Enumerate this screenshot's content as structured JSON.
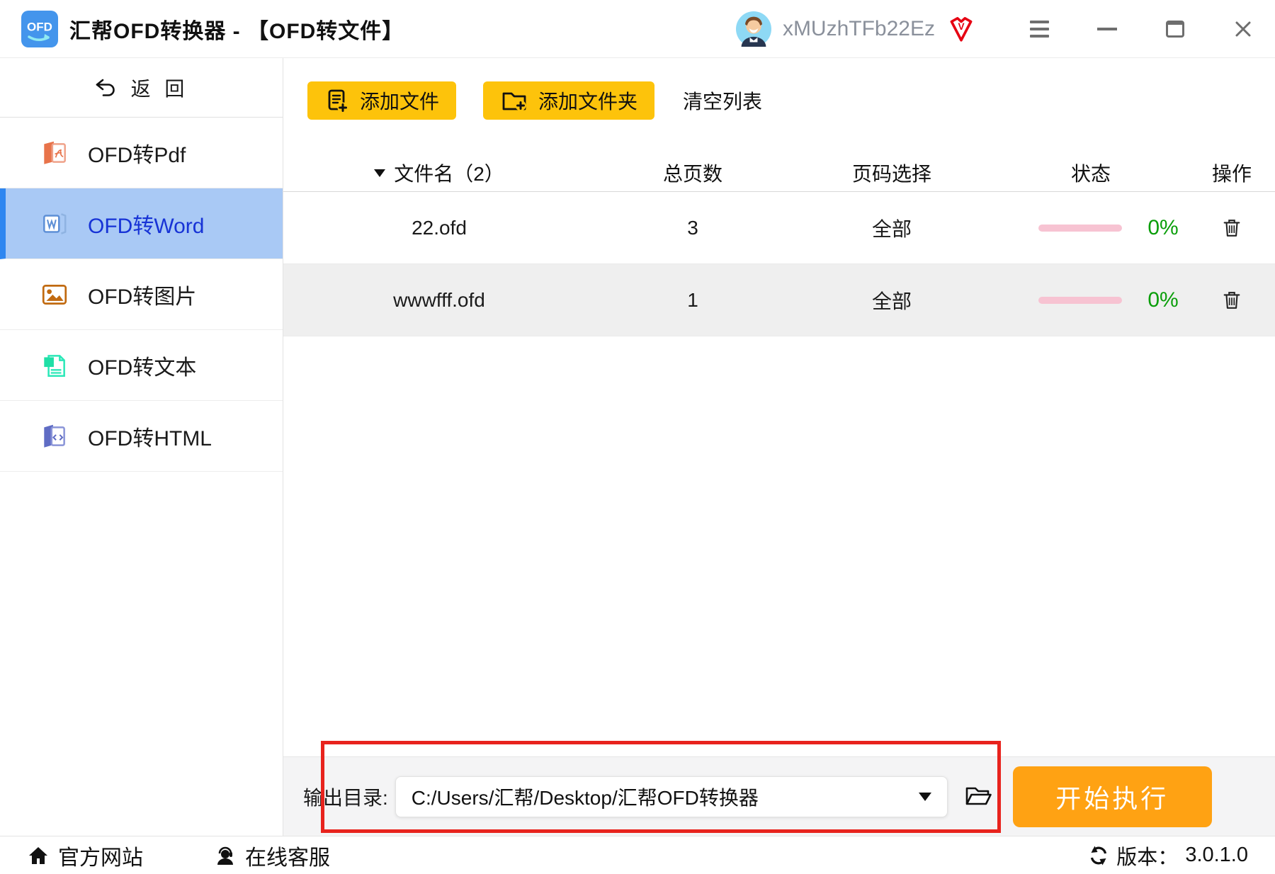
{
  "titlebar": {
    "app_icon_text": "OFD",
    "title": "汇帮OFD转换器 - 【OFD转文件】",
    "username": "xMUzhTFb22Ez",
    "vip_text": "V"
  },
  "sidebar": {
    "back_label": "返 回",
    "items": [
      {
        "label": "OFD转Pdf"
      },
      {
        "label": "OFD转Word",
        "selected": true
      },
      {
        "label": "OFD转图片"
      },
      {
        "label": "OFD转文本"
      },
      {
        "label": "OFD转HTML"
      }
    ]
  },
  "toolbar": {
    "add_file_label": "添加文件",
    "add_folder_label": "添加文件夹",
    "clear_list_label": "清空列表"
  },
  "table": {
    "headers": {
      "filename": "文件名（2）",
      "pages": "总页数",
      "page_select": "页码选择",
      "status": "状态",
      "action": "操作"
    },
    "rows": [
      {
        "filename": "22.ofd",
        "pages": "3",
        "page_select": "全部",
        "progress_percent": "0%"
      },
      {
        "filename": "wwwfff.ofd",
        "pages": "1",
        "page_select": "全部",
        "progress_percent": "0%"
      }
    ]
  },
  "output": {
    "label": "输出目录:",
    "path": "C:/Users/汇帮/Desktop/汇帮OFD转换器",
    "start_button_label": "开始执行"
  },
  "footer": {
    "website_label": "官方网站",
    "support_label": "在线客服",
    "version_label": "版本：",
    "version": "3.0.1.0"
  },
  "colors": {
    "selected_nav_bg": "#a9c9f5",
    "selected_nav_accent": "#2e86f0",
    "selected_nav_text": "#1733d6",
    "add_button_yellow": "#fdc30b",
    "start_button_orange": "#ffa213",
    "progress_pink": "#f7c3d2",
    "percent_green": "#0a9e0a",
    "highlight_red": "#e8231d",
    "vip_red": "#e60012",
    "app_icon_blue": "#4495ec"
  }
}
